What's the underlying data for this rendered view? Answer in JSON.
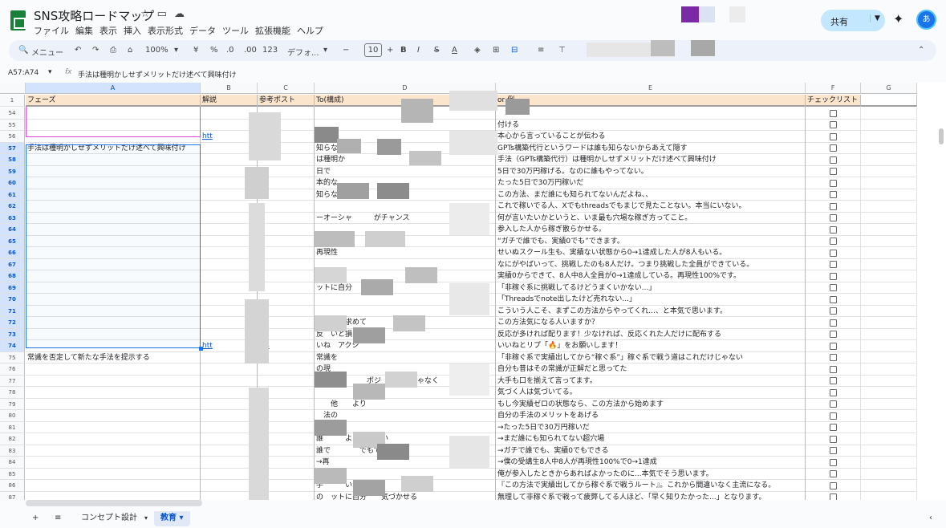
{
  "app": {
    "title": "SNS攻略ロードマップ",
    "share_label": "共有",
    "avatar_letter": "あ"
  },
  "menu": [
    "ファイル",
    "編集",
    "表示",
    "挿入",
    "表示形式",
    "データ",
    "ツール",
    "拡張機能",
    "ヘルプ"
  ],
  "toolbar": {
    "search_placeholder": "メニュー",
    "zoom": "100%",
    "currency": "¥",
    "percent": "%",
    "dec_less": ".0",
    "dec_more": ".00",
    "format123": "123",
    "font": "デフォ...",
    "font_size": "10"
  },
  "formula": {
    "name_box": "A57:A74",
    "fx": "fx",
    "content": "手法は種明かしせずメリットだけ述べて興味付け"
  },
  "columns": [
    "A",
    "B",
    "C",
    "D",
    "E",
    "F",
    "G"
  ],
  "headers": {
    "A": "フェーズ",
    "B": "解説",
    "C": "参考ポスト",
    "D": "To(構成)",
    "E": "or 例",
    "F": "チェックリスト"
  },
  "row_numbers": [
    "54",
    "55",
    "56",
    "57",
    "58",
    "59",
    "60",
    "61",
    "62",
    "63",
    "64",
    "65",
    "66",
    "67",
    "68",
    "69",
    "70",
    "71",
    "72",
    "73",
    "74",
    "75",
    "76",
    "77",
    "78",
    "79",
    "80",
    "81",
    "82",
    "83",
    "84",
    "85",
    "86",
    "87"
  ],
  "col_a": {
    "57": "手法は種明かしせずメリットだけ述べて興味付け",
    "75": "常識を否定して新たな手法を提示する"
  },
  "col_b": {
    "56": "htt",
    "74": "htt"
  },
  "col_c": {
    "74": "eis"
  },
  "col_d": {
    "57": "知らない",
    "58": "は種明か",
    "59": "日で",
    "60": "本的な",
    "61": "知らない、",
    "63": "ーオーシャ　　　がチャンス",
    "65": "誰でもで　　　　　　きる",
    "66": "再現性",
    "69": "ットに自分　　気づか",
    "72": "読　応を求めて",
    "73": "反　いと損を",
    "74": "いね　アクシ",
    "75": "常識を",
    "76": "の現",
    "77": "も　　　　　　ポジ　　ークじゃなく",
    "79": "　　他　　より",
    "80": "　法の",
    "81": "語明",
    "82": "誰　　　よ　　てない",
    "83": "誰で　　　　でもできる",
    "84": "→再",
    "85": "　　　　　　　　　",
    "86": "手　　　いと乗り",
    "87": "の　ットに自分　　気づかせる"
  },
  "col_e": {
    "54": "",
    "55": "付ける",
    "56": "本心から言っていることが伝わる",
    "57": "GPTs構築代行というワードは誰も知らないからあえて隠す",
    "58": "手法（GPTs構築代行）は種明かしせずメリットだけ述べて興味付け",
    "59": "5日で30万円稼げる。なのに誰もやってない。",
    "60": "たった5日で30万円稼いだ",
    "61": "この方法、まだ誰にも知られてないんだよね、、",
    "62": "これで稼いでる人、Xでもthreadsでもまじで見たことない。本当にいない。",
    "63": "何が言いたいかというと、いま最も穴場な稼ぎ方ってこと。",
    "64": "参入した人から稼ぎ散らかせる。",
    "65": "“ガチで誰でも、実績0でも”できます。",
    "66": "せいぬスクール生も、実績ない状態から0→1達成した人が8人もいる。",
    "67": "なにがやばいって、挑戦したのも8人だけ。つまり挑戦した全員ができている。",
    "68": "実績0からできて、8人中8人全員が0→1達成している。再現性100%です。",
    "69": "「非稼ぐ系に挑戦してるけどうまくいかない...」",
    "70": "「Threadsでnote出したけど売れない...」",
    "71": "こういう人こそ、まずこの方法からやってくれ...、と本気で思います。",
    "72": "この方法気になる人いますか？",
    "73": "反応が多ければ配ります！少なければ、反応くれた人だけに配布する",
    "74": "いいねとリプ「🔥」をお願いします！",
    "75": "「非稼ぐ系で実績出してから“稼ぐ系”」稼ぐ系で戦う道はこれだけじゃない",
    "76": "自分も昔はその常識が正解だと思ってた",
    "77": "大手も口を揃えて言ってます。",
    "78": "気づく人は気づいてる。",
    "79": "もし今実績ゼロの状態なら、この方法から始めます",
    "80": "自分の手法のメリットをあげる",
    "81": "→たった5日で30万円稼いだ",
    "82": "→まだ誰にも知られてない超穴場",
    "83": "→ガチで誰でも、実績0でもできる",
    "84": "→僕の受講生8人中8人が再現性100%で0→1達成",
    "85": "俺が参入したときからあればよかったのに...本気でそう思います。",
    "86": "『この方法で実績出してから稼ぐ系で戦うルート』。これから間違いなく主流になる。",
    "87": "無理して非稼ぐ系で戦って疲弊してる人ほど、「早く知りたかった...」となります。"
  },
  "sheets": [
    "コンセプト設計",
    "教育"
  ],
  "active_sheet": "教育",
  "colors": {
    "accent": "#1a73e8",
    "header_fill": "#fce5cd",
    "share_bg": "#c2e7ff",
    "green_logo": "#188038"
  }
}
